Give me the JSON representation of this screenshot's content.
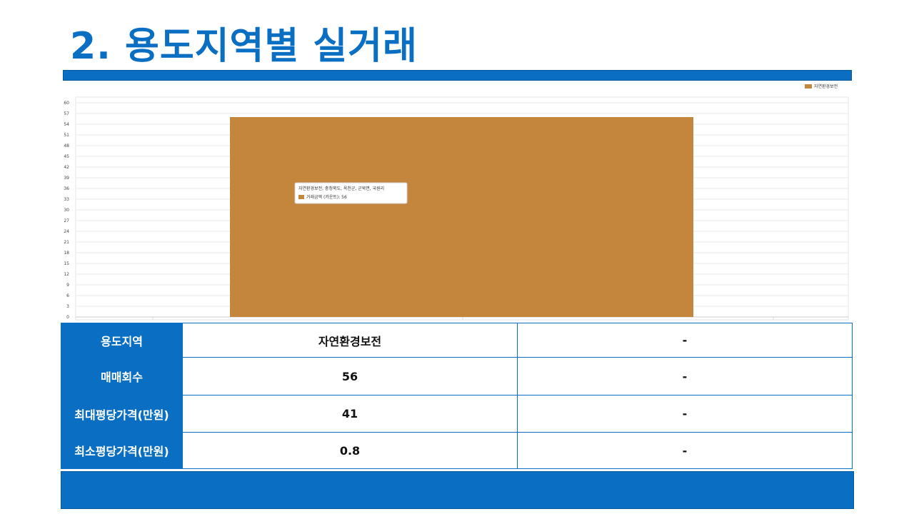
{
  "page": {
    "title": "2. 용도지역별 실거래"
  },
  "chart_data": {
    "type": "bar",
    "categories": [
      "자연환경보전"
    ],
    "series": [
      {
        "name": "자연환경보전",
        "values": [
          56
        ],
        "color": "#c4863c"
      }
    ],
    "yticks": [
      "60",
      "57",
      "54",
      "51",
      "48",
      "45",
      "42",
      "39",
      "36",
      "33",
      "30",
      "27",
      "24",
      "21",
      "18",
      "15",
      "12",
      "9",
      "6",
      "3",
      "0"
    ],
    "ylim": [
      0,
      60
    ],
    "grid": true,
    "legend_position": "top-right",
    "tooltip": {
      "title": "자연환경보전, 충청북도, 옥천군, 군북면, 국원리",
      "line": "거래금액 (카운트): 56"
    }
  },
  "table": {
    "rows": [
      {
        "label": "용도지역",
        "value": "자연환경보전",
        "extra": "-"
      },
      {
        "label": "매매회수",
        "value": "56",
        "extra": "-"
      },
      {
        "label": "최대평당가격(만원)",
        "value": "41",
        "extra": "-"
      },
      {
        "label": "최소평당가격(만원)",
        "value": "0.8",
        "extra": "-"
      }
    ]
  }
}
